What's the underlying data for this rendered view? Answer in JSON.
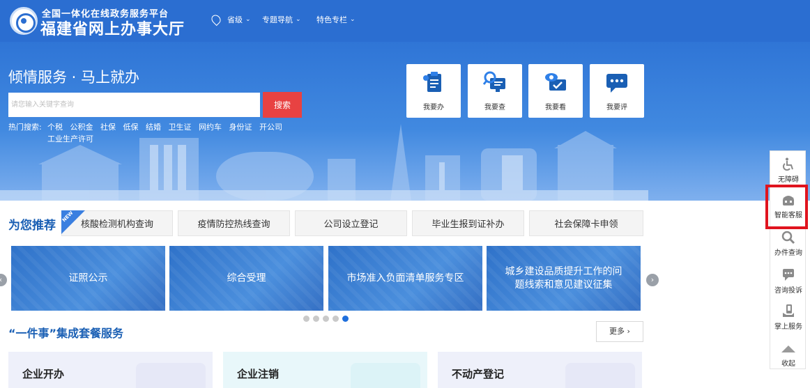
{
  "header": {
    "logo_line1": "全国一体化在线政务服务平台",
    "logo_line2": "福建省网上办事大厅",
    "nav": [
      {
        "label": "省级"
      },
      {
        "label": "专题导航"
      },
      {
        "label": "特色专栏"
      }
    ]
  },
  "banner": {
    "title": "倾情服务 · 马上就办",
    "search_placeholder": "请您输入关键字查询",
    "search_button": "搜索",
    "hot_label": "热门搜索:",
    "hot_links": [
      "个税",
      "公积金",
      "社保",
      "低保",
      "结婚",
      "卫生证",
      "网约车",
      "身份证",
      "开公司",
      "工业生产许可"
    ],
    "tiles": [
      {
        "label": "我要办",
        "icon": "clipboard-icon"
      },
      {
        "label": "我要查",
        "icon": "magnifier-monitor-icon"
      },
      {
        "label": "我要看",
        "icon": "eye-board-icon"
      },
      {
        "label": "我要评",
        "icon": "chat-bubble-icon"
      }
    ]
  },
  "recommend": {
    "title": "为您推荐",
    "new_tag": "NEW",
    "items": [
      "核酸检测机构查询",
      "疫情防控热线查询",
      "公司设立登记",
      "毕业生报到证补办",
      "社会保障卡申领"
    ]
  },
  "carousel": {
    "slides": [
      "证照公示",
      "综合受理",
      "市场准入负面清单服务专区",
      "城乡建设品质提升工作的问题线索和意见建议征集"
    ],
    "prev_arrow": "‹",
    "next_arrow": "›",
    "dot_count": 5,
    "active_dot": 5
  },
  "packages": {
    "title": "“一件事”集成套餐服务",
    "more_label": "更多",
    "cards": [
      {
        "title": "企业开办",
        "color": "#eef0fa"
      },
      {
        "title": "企业注销",
        "color": "#e8f7fa"
      },
      {
        "title": "不动产登记",
        "color": "#eef0fa"
      }
    ]
  },
  "sidebar": {
    "items": [
      {
        "label": "无障碍",
        "icon": "wheelchair-icon"
      },
      {
        "label": "智能客服",
        "icon": "robot-icon"
      },
      {
        "label": "办件查询",
        "icon": "search-icon"
      },
      {
        "label": "咨询投诉",
        "icon": "chat-icon"
      },
      {
        "label": "掌上服务",
        "icon": "hand-phone-icon"
      },
      {
        "label": "收起",
        "icon": "collapse-up-icon"
      }
    ]
  },
  "colors": {
    "brand_blue": "#2b6ed1",
    "search_red": "#e84242",
    "title_blue": "#1a5fb4",
    "highlight_red": "#e0141e"
  }
}
